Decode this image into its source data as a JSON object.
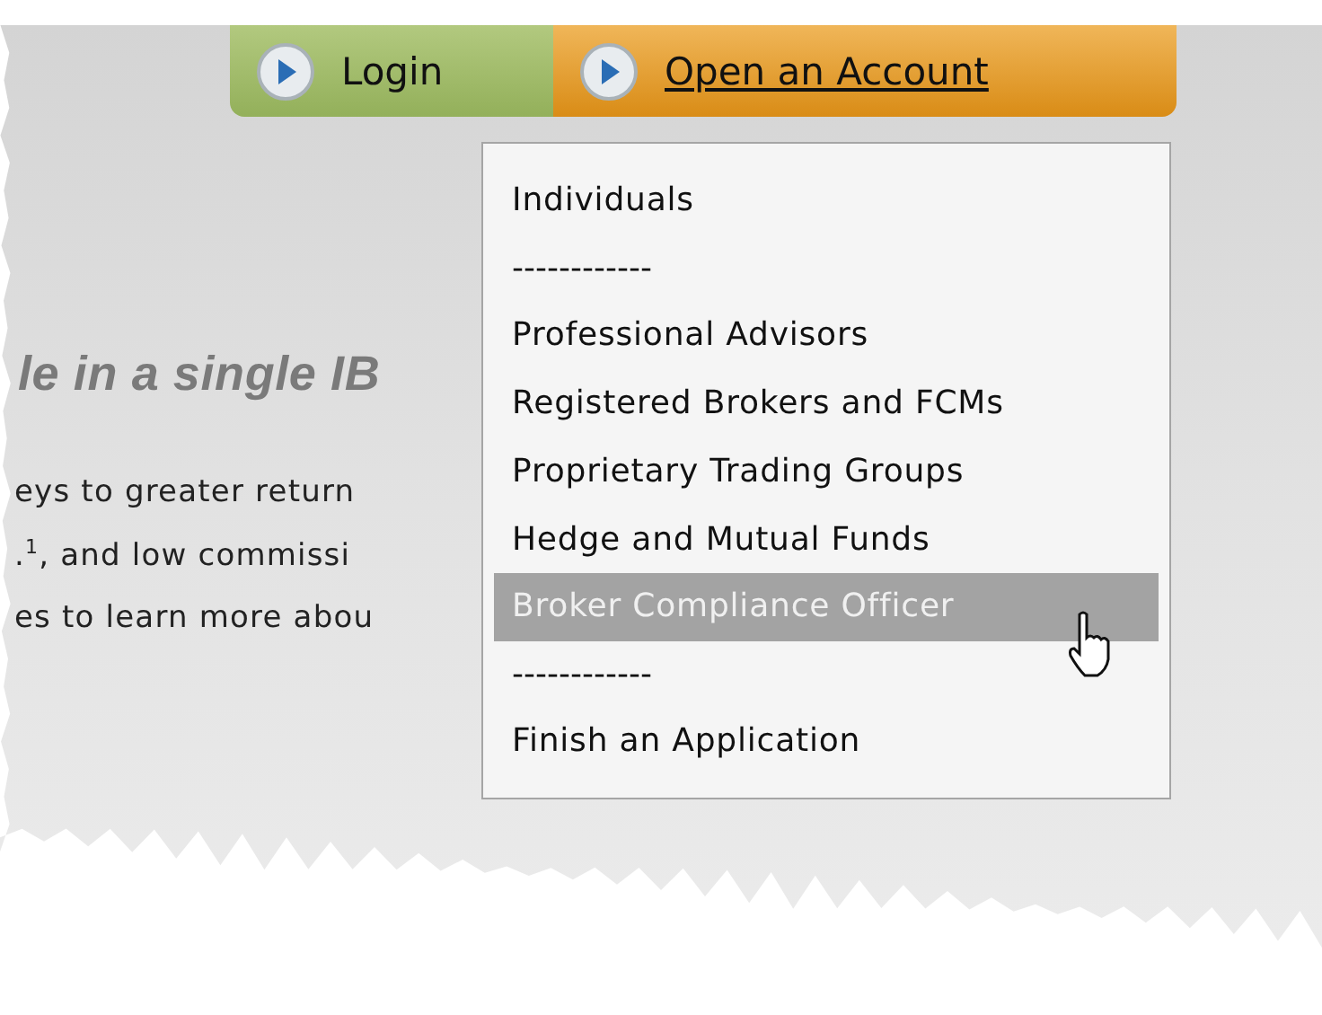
{
  "nav_buttons": [
    {
      "label": "Login",
      "kind": "login",
      "underlined": false
    },
    {
      "label": "Open an Account",
      "kind": "account",
      "underlined": true
    }
  ],
  "heading": "le in a single IB",
  "paragraph_lines": [
    "eys to greater return",
    ".$^{1}$, and low commissi",
    "es to learn more abou"
  ],
  "menu": {
    "items": [
      {
        "kind": "item",
        "label": "Individuals",
        "selected": false
      },
      {
        "kind": "separator",
        "label": "------------"
      },
      {
        "kind": "item",
        "label": "Professional Advisors",
        "selected": false
      },
      {
        "kind": "item",
        "label": "Registered Brokers and FCMs",
        "selected": false
      },
      {
        "kind": "item",
        "label": "Proprietary Trading Groups",
        "selected": false
      },
      {
        "kind": "item",
        "label": "Hedge and Mutual Funds",
        "selected": false
      },
      {
        "kind": "item",
        "label": "Broker Compliance Officer",
        "selected": true
      },
      {
        "kind": "separator",
        "label": "------------"
      },
      {
        "kind": "item",
        "label": "Finish an Application",
        "selected": false
      }
    ]
  }
}
